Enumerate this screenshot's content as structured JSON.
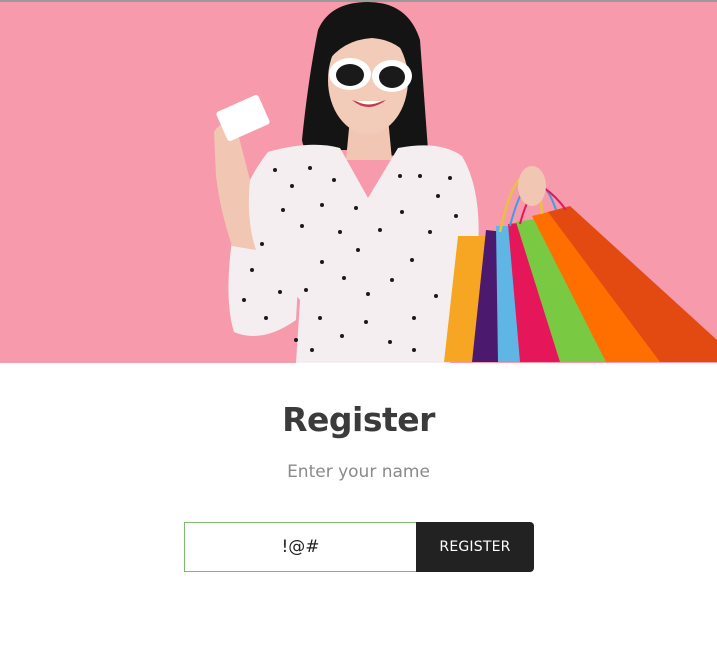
{
  "hero": {
    "image_subject": "woman-with-credit-card-and-shopping-bags",
    "background_color": "#f79aac"
  },
  "register": {
    "title": "Register",
    "subtitle": "Enter your name",
    "name_input_value": "!@#",
    "button_label": "REGISTER"
  },
  "colors": {
    "title": "#3b3b3b",
    "subtitle": "#8a8a8a",
    "input_border": "#7cb96a",
    "button_bg": "#222222",
    "button_text": "#ffffff"
  }
}
